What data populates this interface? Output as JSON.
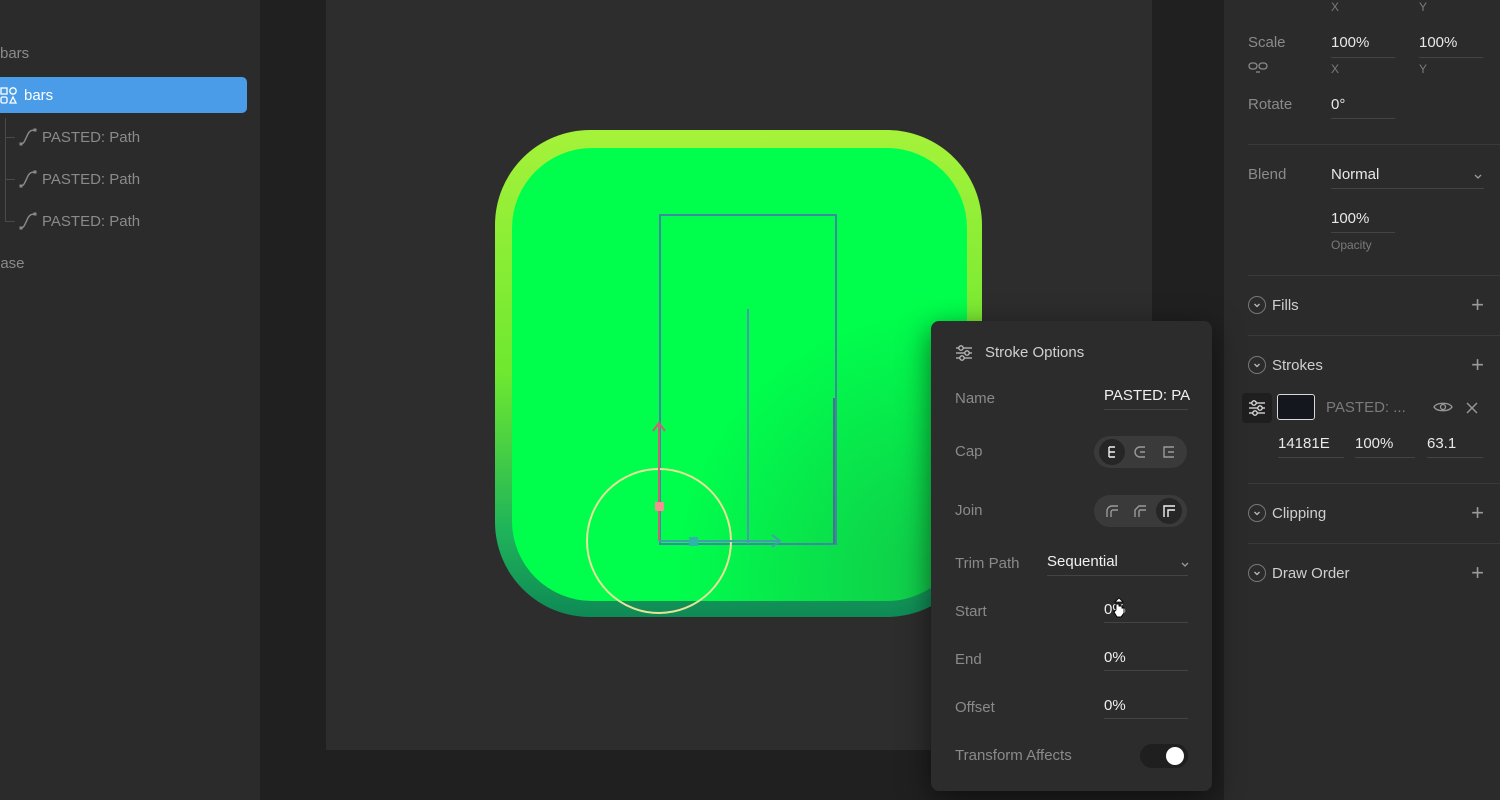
{
  "hierarchy": {
    "items": [
      {
        "label": "bars"
      },
      {
        "label": "bars"
      },
      {
        "label": "PASTED: Path"
      },
      {
        "label": "PASTED: Path"
      },
      {
        "label": "PASTED: Path"
      },
      {
        "label": "base"
      }
    ]
  },
  "transform": {
    "top_x_label": "X",
    "top_y_label": "Y",
    "scale_label": "Scale",
    "scale_x": "100%",
    "scale_y": "100%",
    "scale_x_sub": "X",
    "scale_y_sub": "Y",
    "rotate_label": "Rotate",
    "rotate_value": "0°",
    "blend_label": "Blend",
    "blend_value": "Normal",
    "opacity_value": "100%",
    "opacity_label": "Opacity"
  },
  "sections": {
    "fills": "Fills",
    "strokes": "Strokes",
    "clipping": "Clipping",
    "draw_order": "Draw Order"
  },
  "stroke_row": {
    "name": "PASTED: ...",
    "color_hex": "14181E",
    "opacity": "100%",
    "thickness": "63.1",
    "swatch_color": "#14181e"
  },
  "stroke_options": {
    "title": "Stroke Options",
    "name_label": "Name",
    "name_value": "PASTED: PA",
    "cap_label": "Cap",
    "join_label": "Join",
    "trim_label": "Trim Path",
    "trim_value": "Sequential",
    "start_label": "Start",
    "start_value": "0%",
    "end_label": "End",
    "end_value": "0%",
    "offset_label": "Offset",
    "offset_value": "0%",
    "transform_label": "Transform Affects"
  },
  "colors": {
    "accent": "#4a9ce8",
    "icon_green": "#00ff4c"
  }
}
